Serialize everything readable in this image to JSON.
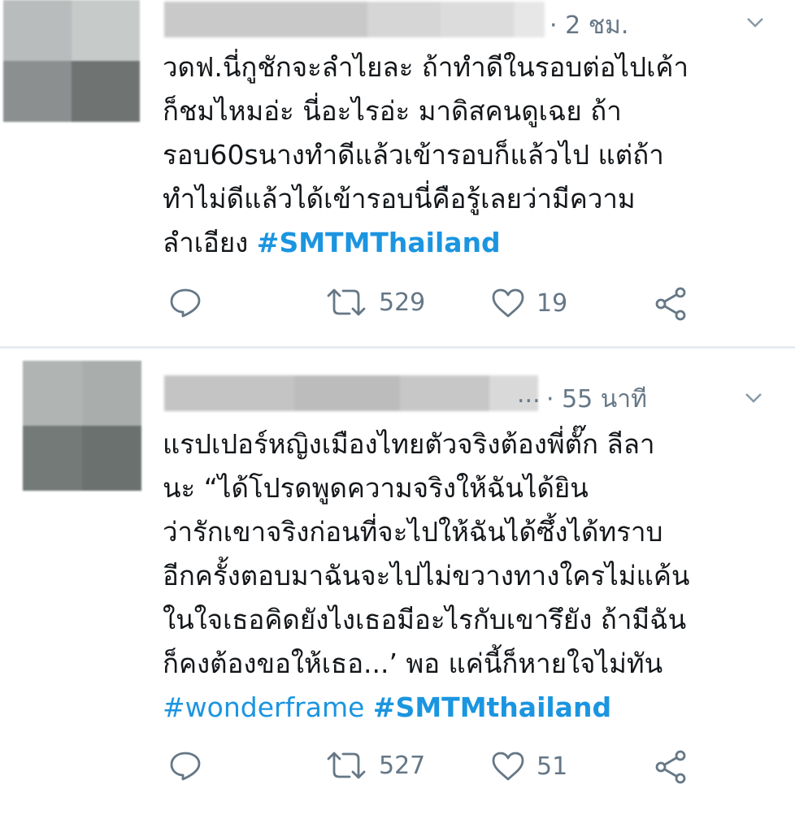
{
  "colors": {
    "link": "#1b95e0",
    "muted": "#657786",
    "text": "#14171a",
    "divider": "#e6ecf0"
  },
  "tweets": [
    {
      "time": "· 2 ชม.",
      "lines": [
        "วดฟ.นี่กูชักจะลำไยละ ถ้าทำดีในรอบต่อไปเค้า",
        "ก็ชมไหมอ่ะ นี่อะไรอ่ะ มาดิสคนดูเฉย ถ้า",
        "รอบ60sนางทำดีแล้วเข้ารอบก็แล้วไป แต่ถ้า",
        "ทำไม่ดีแล้วได้เข้ารอบนี่คือรู้เลยว่ามีความ"
      ],
      "last_line_text": "ลำเอียง ",
      "hashtags": [
        "#SMTMThailand"
      ],
      "actions": {
        "reply_icon": "reply-icon",
        "retweet_icon": "retweet-icon",
        "retweets": "529",
        "like_icon": "heart-icon",
        "likes": "19",
        "share_icon": "share-icon"
      }
    },
    {
      "time": "· 55 นาที",
      "ellipsis": "...",
      "lines": [
        "แรปเปอร์หญิงเมืองไทยตัวจริงต้องพี่ตั๊ก ลีลา",
        "นะ “ได้โปรดพูดความจริงให้ฉันได้ยิน",
        "ว่ารักเขาจริงก่อนที่จะไปให้ฉันได้ซึ้งได้ทราบ",
        "อีกครั้งตอบมาฉันจะไปไม่ขวางทางใครไม่แค้น",
        "ในใจเธอคิดยังไงเธอมีอะไรกับเขารึยัง ถ้ามีฉัน",
        "ก็คงต้องขอให้เธอ...’ พอ แค่นี้ก็หายใจไม่ทัน"
      ],
      "hashtags": [
        "#wonderframe",
        "#SMTMthailand"
      ],
      "actions": {
        "reply_icon": "reply-icon",
        "retweet_icon": "retweet-icon",
        "retweets": "527",
        "like_icon": "heart-icon",
        "likes": "51",
        "share_icon": "share-icon"
      }
    }
  ]
}
